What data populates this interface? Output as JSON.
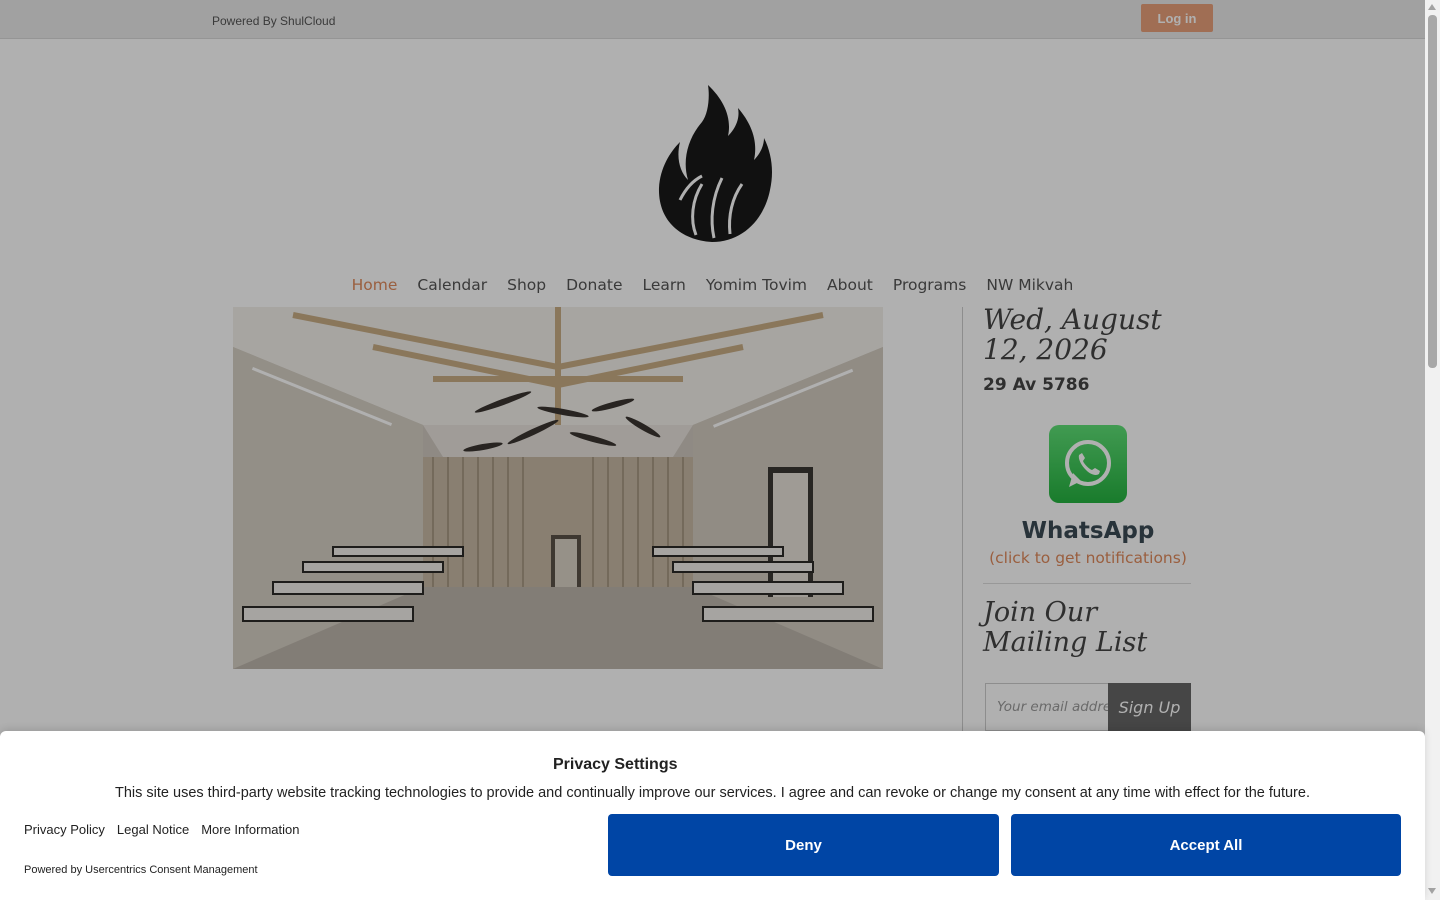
{
  "topbar": {
    "powered_by": "Powered By ShulCloud",
    "login_label": "Log in"
  },
  "logo": {
    "icon": "flame-logo-icon"
  },
  "nav": {
    "items": [
      "Home",
      "Calendar",
      "Shop",
      "Donate",
      "Learn",
      "Yomim Tovim",
      "About",
      "Programs",
      "NW Mikvah"
    ],
    "active": "Home"
  },
  "hero": {
    "icon": "sanctuary-interior-image"
  },
  "sidebar": {
    "date": "Wed, August 12, 2026",
    "hebrew_date": "29 Av 5786",
    "whatsapp": {
      "icon": "whatsapp-icon",
      "label": "WhatsApp",
      "hint": "(click to get notifications)"
    },
    "mailing": {
      "title": "Join Our Mailing List",
      "email_placeholder": "Your email address",
      "signup_label": "Sign Up"
    }
  },
  "consent": {
    "title": "Privacy Settings",
    "text": "This site uses third-party website tracking technologies to provide and continually improve our services. I agree and can revoke or change my consent at any time with effect for the future.",
    "links": [
      "Privacy Policy",
      "Legal Notice",
      "More Information"
    ],
    "powered_by": "Powered by Usercentrics Consent Management",
    "deny_label": "Deny",
    "accept_label": "Accept All"
  },
  "colors": {
    "accent": "#e08a5c",
    "consent_button": "#0045a5"
  }
}
